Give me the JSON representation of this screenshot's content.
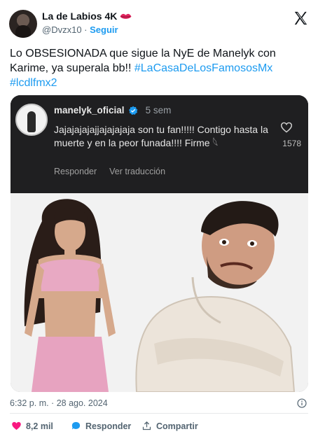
{
  "author": {
    "display_name": "La de Labios 4K",
    "handle": "@Dvzx10",
    "separator": "·",
    "follow_label": "Seguir",
    "name_emoji_icon": "lips-icon"
  },
  "tweet": {
    "text_plain": "Lo OBSESIONADA que sigue la NyE de Manelyk con Karime, ya superala bb!!",
    "hashtag_1": "#LaCasaDeLosFamososMx",
    "hashtag_2": "#lcdlfmx2"
  },
  "embed": {
    "username": "manelyk_oficial",
    "time": "5 sem",
    "comment": "Jajajajajajjajajajaja son tu fan!!!!! Contigo hasta la muerte y en la peor funada!!!! Firme 𓆩",
    "like_count": "1578",
    "reply_label": "Responder",
    "translate_label": "Ver traducción"
  },
  "footer": {
    "timestamp": "6:32 p. m. · 28 ago. 2024",
    "likes": "8,2 mil",
    "reply_label": "Responder",
    "share_label": "Compartir"
  },
  "colors": {
    "accent": "#1d9bf0",
    "like": "#f91880",
    "text": "#0f1419",
    "muted": "#536471",
    "embed_bg": "#1f1f21"
  }
}
